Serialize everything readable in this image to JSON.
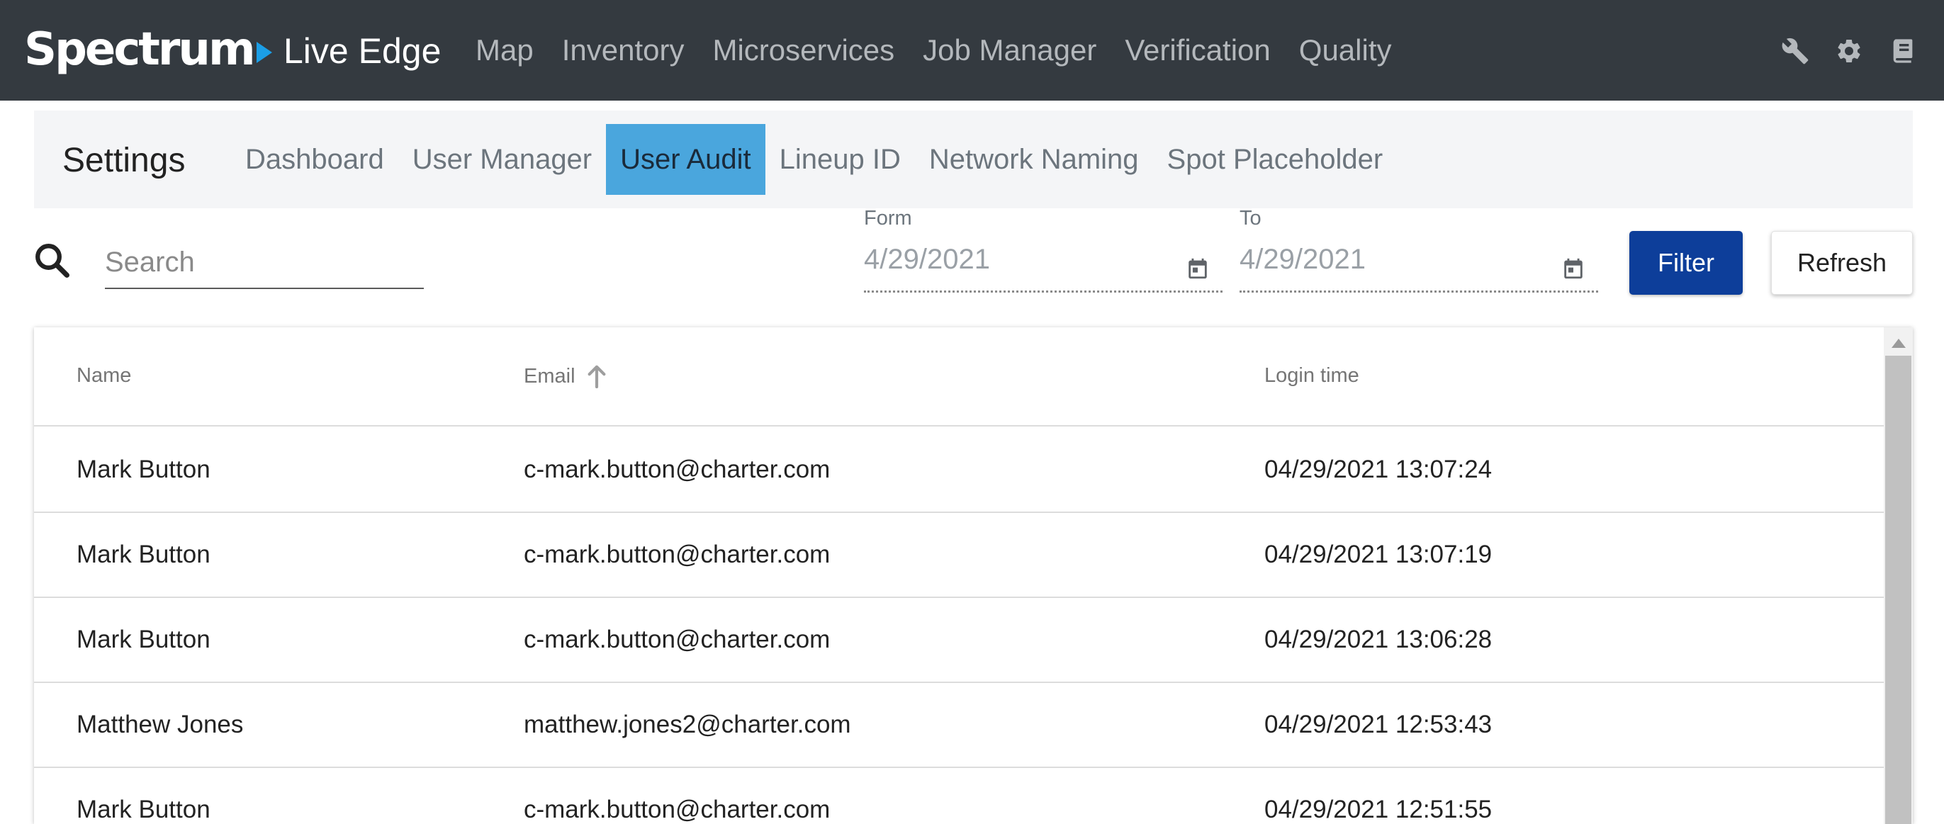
{
  "brand": {
    "logo_text": "Spectrum",
    "app_name": "Live Edge"
  },
  "nav": {
    "links": [
      "Map",
      "Inventory",
      "Microservices",
      "Job Manager",
      "Verification",
      "Quality"
    ],
    "icons": [
      "wrench-icon",
      "gear-icon",
      "book-icon"
    ]
  },
  "settings": {
    "title": "Settings",
    "tabs": [
      "Dashboard",
      "User Manager",
      "User Audit",
      "Lineup ID",
      "Network Naming",
      "Spot Placeholder"
    ],
    "active_tab": "User Audit"
  },
  "filters": {
    "search_placeholder": "Search",
    "from_label": "Form",
    "from_value": "4/29/2021",
    "to_label": "To",
    "to_value": "4/29/2021",
    "filter_label": "Filter",
    "refresh_label": "Refresh"
  },
  "table": {
    "columns": [
      "Name",
      "Email",
      "Login time"
    ],
    "sorted_column": "Email",
    "sort_direction": "ascending",
    "rows": [
      {
        "name": "Mark Button",
        "email": "c-mark.button@charter.com",
        "login_time": "04/29/2021 13:07:24"
      },
      {
        "name": "Mark Button",
        "email": "c-mark.button@charter.com",
        "login_time": "04/29/2021 13:07:19"
      },
      {
        "name": "Mark Button",
        "email": "c-mark.button@charter.com",
        "login_time": "04/29/2021 13:06:28"
      },
      {
        "name": "Matthew Jones",
        "email": "matthew.jones2@charter.com",
        "login_time": "04/29/2021 12:53:43"
      },
      {
        "name": "Mark Button",
        "email": "c-mark.button@charter.com",
        "login_time": "04/29/2021 12:51:55"
      }
    ]
  },
  "colors": {
    "topnav_bg": "#343a40",
    "brand_accent": "#1b9ee6",
    "active_tab_bg": "#4aa6dd",
    "filter_button_bg": "#0d3e9a"
  }
}
